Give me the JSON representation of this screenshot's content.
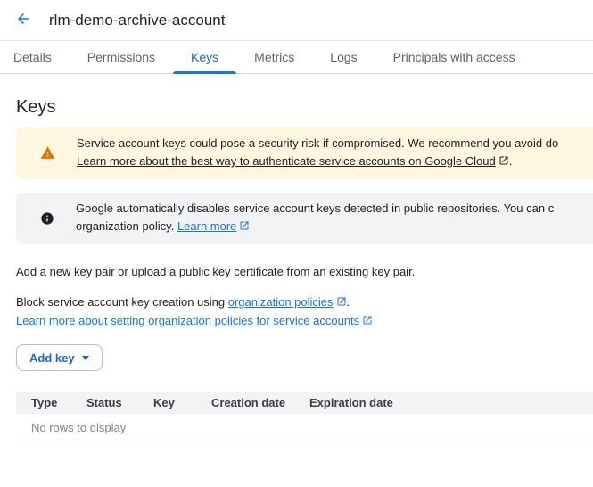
{
  "header": {
    "title": "rlm-demo-archive-account"
  },
  "tabs": [
    {
      "label": "Details",
      "active": false
    },
    {
      "label": "Permissions",
      "active": false
    },
    {
      "label": "Keys",
      "active": true
    },
    {
      "label": "Metrics",
      "active": false
    },
    {
      "label": "Logs",
      "active": false
    },
    {
      "label": "Principals with access",
      "active": false
    }
  ],
  "page": {
    "heading": "Keys",
    "warning_banner": {
      "line1": "Service account keys could pose a security risk if compromised. We recommend you avoid do",
      "link": "Learn more about the best way to authenticate service accounts on Google Cloud",
      "suffix": "."
    },
    "info_banner": {
      "line1": "Google automatically disables service account keys detected in public repositories. You can c",
      "line2_prefix": "organization policy. ",
      "link": "Learn more"
    },
    "intro": "Add a new key pair or upload a public key certificate from an existing key pair.",
    "block": {
      "prefix": "Block service account key creation using ",
      "link": "organization policies",
      "suffix": "."
    },
    "learn_more_link": "Learn more about setting organization policies for service accounts",
    "add_key_label": "Add key"
  },
  "table": {
    "columns": [
      "Type",
      "Status",
      "Key",
      "Creation date",
      "Expiration date"
    ],
    "empty_message": "No rows to display"
  },
  "colors": {
    "accent_blue": "#1967D2",
    "link_blue": "#1A73E8",
    "warning_bg": "#FEF7E0",
    "warning_icon": "#E37400",
    "info_bg": "#F1F3F4",
    "table_header_bg": "#F1F3F4",
    "muted_text": "#80868B",
    "tab_text": "#5F6368"
  }
}
